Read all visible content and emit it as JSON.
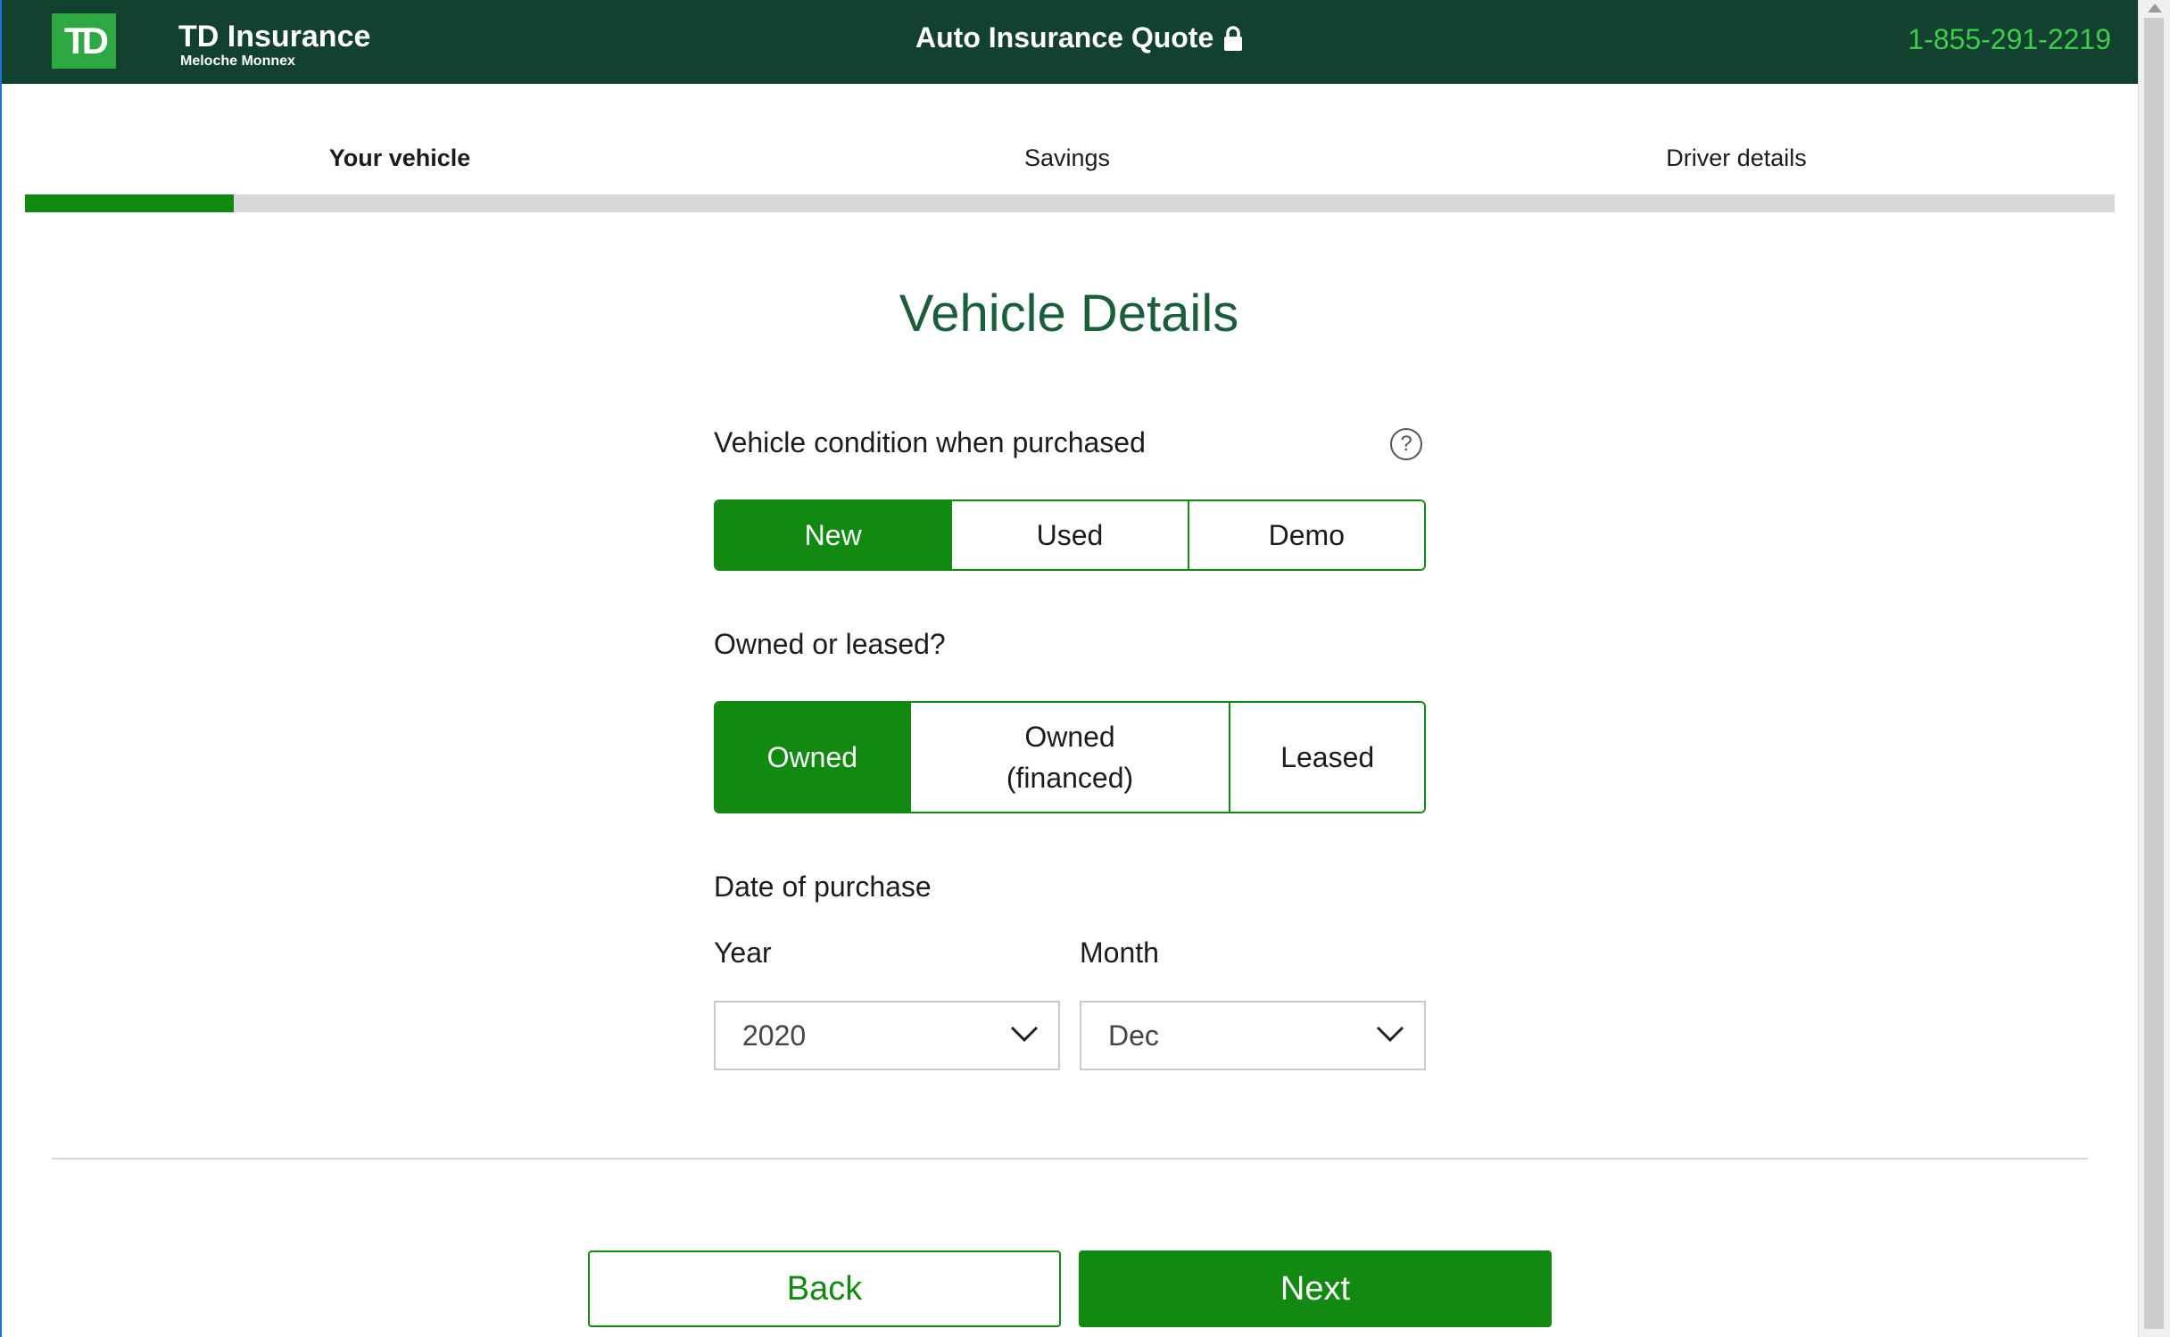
{
  "header": {
    "logo_text": "TD",
    "brand_name": "TD Insurance",
    "brand_sub": "Meloche Monnex",
    "title": "Auto Insurance Quote",
    "phone": "1-855-291-2219"
  },
  "steps": [
    {
      "label": "Your vehicle",
      "active": true
    },
    {
      "label": "Savings",
      "active": false
    },
    {
      "label": "Driver details",
      "active": false
    }
  ],
  "progress": {
    "fraction": 0.1
  },
  "page_title": "Vehicle Details",
  "condition": {
    "label": "Vehicle condition when purchased",
    "help": "?",
    "options": [
      "New",
      "Used",
      "Demo"
    ],
    "selected": "New"
  },
  "ownership": {
    "label": "Owned or leased?",
    "options": [
      "Owned",
      "Owned (financed)",
      "Leased"
    ],
    "selected": "Owned"
  },
  "purchase_date": {
    "label": "Date of purchase",
    "year_label": "Year",
    "year_value": "2020",
    "month_label": "Month",
    "month_value": "Dec"
  },
  "buttons": {
    "back": "Back",
    "next": "Next"
  },
  "colors": {
    "header_bg": "#134130",
    "accent": "#128a12",
    "phone": "#3ecc4c",
    "title": "#1b5e3a"
  }
}
